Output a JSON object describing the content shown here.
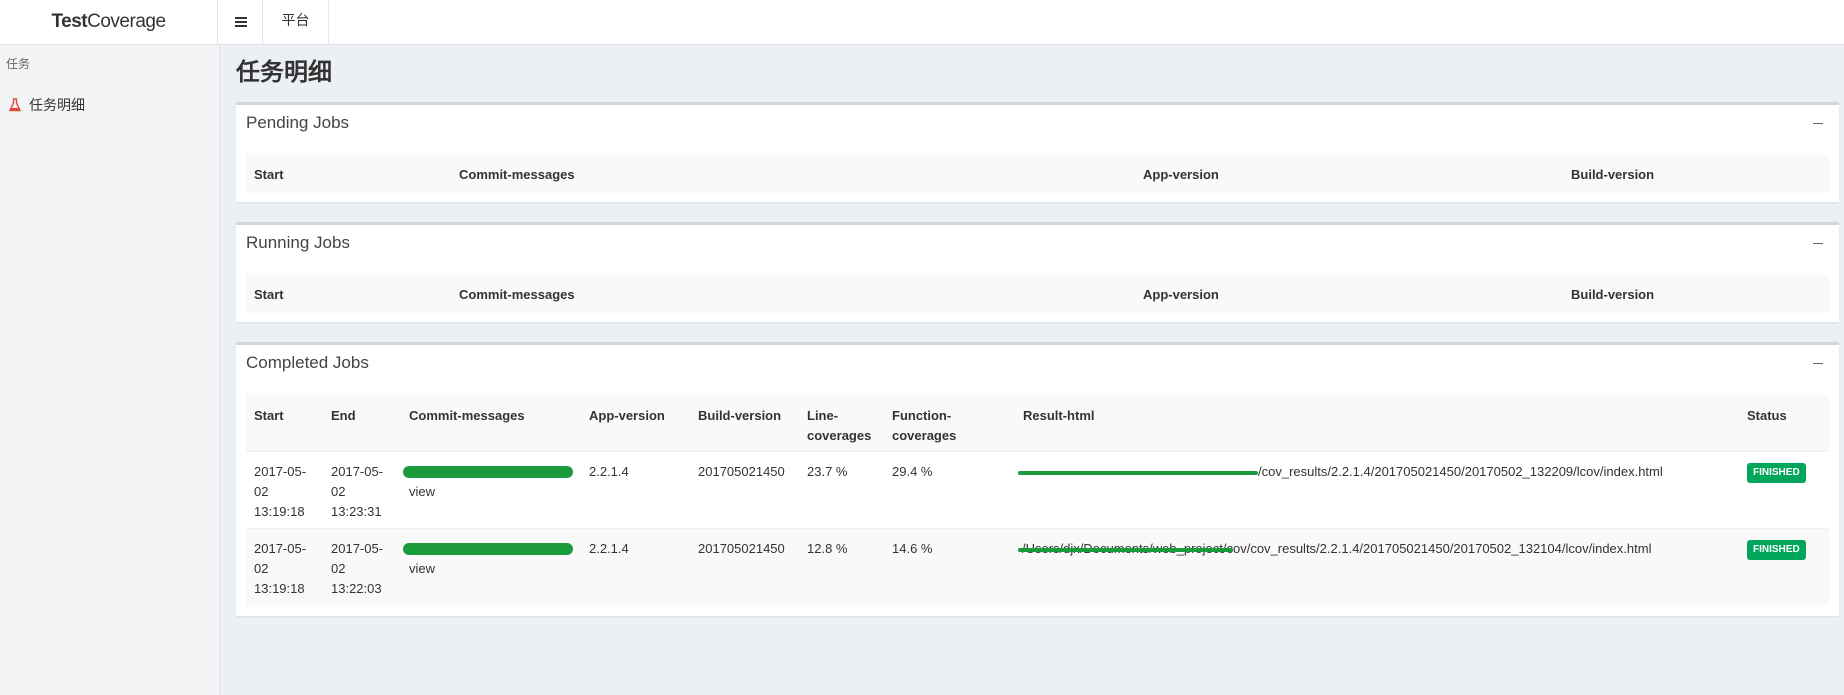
{
  "header": {
    "logo_bold": "Test",
    "logo_rest": "Coverage",
    "nav_platform": "平台"
  },
  "sidebar": {
    "header": "任务",
    "items": [
      {
        "label": "任务明细",
        "icon": "flask-icon"
      }
    ]
  },
  "page_title": "任务明细",
  "pending": {
    "title": "Pending Jobs",
    "columns": [
      "Start",
      "Commit-messages",
      "App-version",
      "Build-version"
    ]
  },
  "running": {
    "title": "Running Jobs",
    "columns": [
      "Start",
      "Commit-messages",
      "App-version",
      "Build-version"
    ]
  },
  "completed": {
    "title": "Completed Jobs",
    "columns": [
      "Start",
      "End",
      "Commit-messages",
      "App-version",
      "Build-version",
      "Line-coverages",
      "Function-coverages",
      "Result-html",
      "Status"
    ],
    "rows": [
      {
        "start": "2017-05-02 13:19:18",
        "end": "2017-05-02 13:23:31",
        "commit_tail": "view",
        "app_version": "2.2.1.4",
        "build_version": "201705021450",
        "line_cov": "23.7 %",
        "func_cov": "29.4 %",
        "result_html": "/cov_results/2.2.1.4/201705021450/20170502_132209/lcov/index.html",
        "status": "FINISHED"
      },
      {
        "start": "2017-05-02 13:19:18",
        "end": "2017-05-02 13:22:03",
        "commit_tail": "view",
        "app_version": "2.2.1.4",
        "build_version": "201705021450",
        "line_cov": "12.8 %",
        "func_cov": "14.6 %",
        "result_html": "/Users/djx/Documents/web_project/cov/cov_results/2.2.1.4/201705021450/20170502_132104/lcov/index.html",
        "status": "FINISHED"
      }
    ]
  },
  "colors": {
    "status_green": "#00a65a",
    "redaction": "#1a9a3a",
    "icon_red": "#dd4b39"
  }
}
